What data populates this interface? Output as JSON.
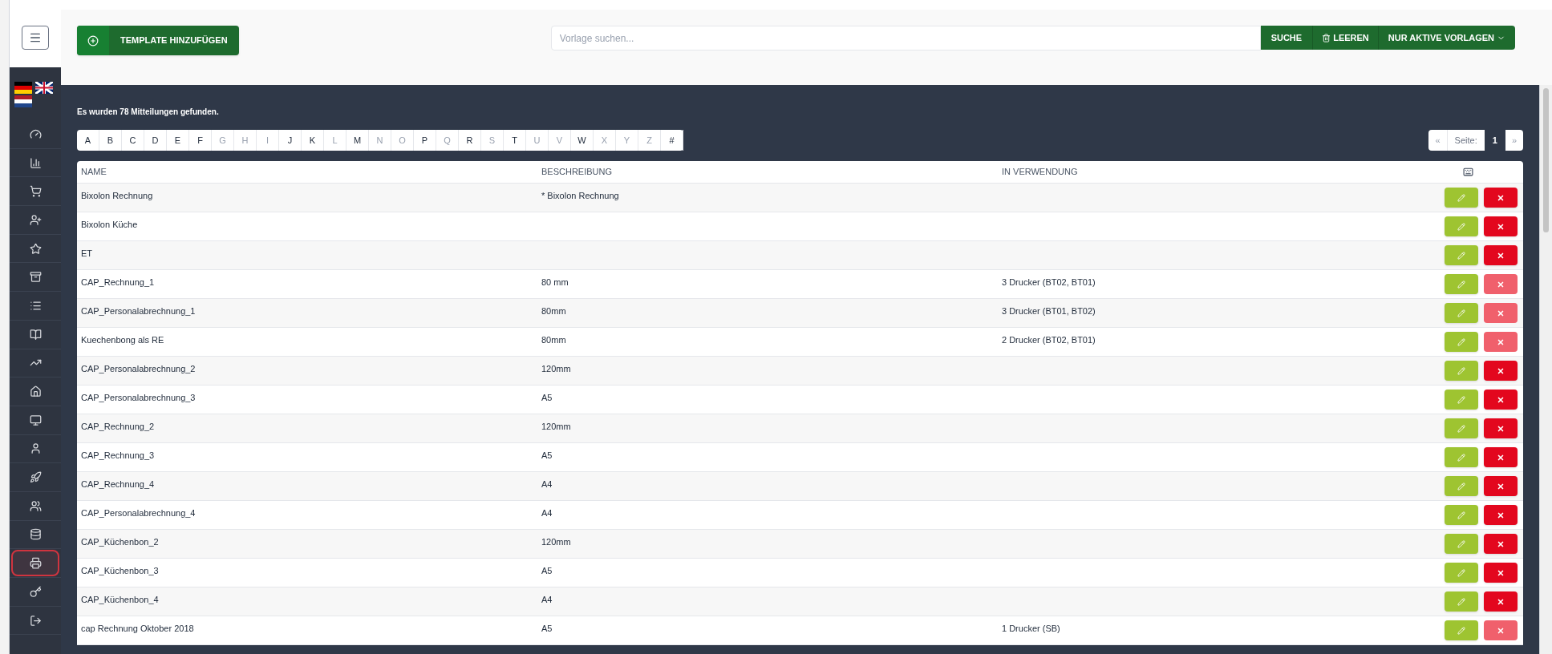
{
  "sidebar": {
    "languages": [
      {
        "kind": "de"
      },
      {
        "kind": "uk"
      },
      {
        "kind": "nl"
      }
    ],
    "items": [
      {
        "kind": "gauge",
        "selected": false
      },
      {
        "kind": "chart",
        "selected": false
      },
      {
        "kind": "cart",
        "selected": false
      },
      {
        "kind": "user-plus",
        "selected": false
      },
      {
        "kind": "star",
        "selected": false
      },
      {
        "kind": "archive",
        "selected": false
      },
      {
        "kind": "list",
        "selected": false
      },
      {
        "kind": "book",
        "selected": false
      },
      {
        "kind": "trend",
        "selected": false
      },
      {
        "kind": "home",
        "selected": false
      },
      {
        "kind": "monitor",
        "selected": false
      },
      {
        "kind": "user",
        "selected": false
      },
      {
        "kind": "rocket",
        "selected": false
      },
      {
        "kind": "users",
        "selected": false
      },
      {
        "kind": "database",
        "selected": false
      },
      {
        "kind": "printer",
        "selected": true
      },
      {
        "kind": "key",
        "selected": false
      },
      {
        "kind": "logout",
        "selected": false
      }
    ]
  },
  "toolbar": {
    "add_button": "TEMPLATE HINZUFÜGEN",
    "search": {
      "placeholder": "Vorlage suchen..."
    },
    "search_button": "SUCHE",
    "clear_button": "LEEREN",
    "filter_button": "NUR AKTIVE VORLAGEN"
  },
  "result_text": "Es wurden 78 Mitteilungen gefunden.",
  "alphabet": [
    {
      "label": "A",
      "disabled": false
    },
    {
      "label": "B",
      "disabled": false
    },
    {
      "label": "C",
      "disabled": false
    },
    {
      "label": "D",
      "disabled": false
    },
    {
      "label": "E",
      "disabled": false
    },
    {
      "label": "F",
      "disabled": false
    },
    {
      "label": "G",
      "disabled": true
    },
    {
      "label": "H",
      "disabled": true
    },
    {
      "label": "I",
      "disabled": true
    },
    {
      "label": "J",
      "disabled": false
    },
    {
      "label": "K",
      "disabled": false
    },
    {
      "label": "L",
      "disabled": true
    },
    {
      "label": "M",
      "disabled": false
    },
    {
      "label": "N",
      "disabled": true
    },
    {
      "label": "O",
      "disabled": true
    },
    {
      "label": "P",
      "disabled": false
    },
    {
      "label": "Q",
      "disabled": true
    },
    {
      "label": "R",
      "disabled": false
    },
    {
      "label": "S",
      "disabled": true
    },
    {
      "label": "T",
      "disabled": false
    },
    {
      "label": "U",
      "disabled": true
    },
    {
      "label": "V",
      "disabled": true
    },
    {
      "label": "W",
      "disabled": false
    },
    {
      "label": "X",
      "disabled": true
    },
    {
      "label": "Y",
      "disabled": true
    },
    {
      "label": "Z",
      "disabled": true
    },
    {
      "label": "#",
      "disabled": false
    }
  ],
  "pagination": {
    "prev": "«",
    "label": "Seite:",
    "page": "1",
    "next": "»"
  },
  "table": {
    "columns": [
      "NAME",
      "BESCHREIBUNG",
      "IN VERWENDUNG"
    ],
    "rows": [
      {
        "name": "Bixolon Rechnung",
        "description": "* Bixolon Rechnung",
        "in_use": "",
        "delete_disabled": false
      },
      {
        "name": "Bixolon Küche",
        "description": "",
        "in_use": "",
        "delete_disabled": false
      },
      {
        "name": "ET",
        "description": "",
        "in_use": "",
        "delete_disabled": false
      },
      {
        "name": "CAP_Rechnung_1",
        "description": "80 mm",
        "in_use": "3 Drucker (BT02, BT01)",
        "delete_disabled": true
      },
      {
        "name": "CAP_Personalabrechnung_1",
        "description": "80mm",
        "in_use": "3 Drucker (BT01, BT02)",
        "delete_disabled": true
      },
      {
        "name": "Kuechenbong als RE",
        "description": "80mm",
        "in_use": "2 Drucker (BT02, BT01)",
        "delete_disabled": true
      },
      {
        "name": "CAP_Personalabrechnung_2",
        "description": "120mm",
        "in_use": "",
        "delete_disabled": false
      },
      {
        "name": "CAP_Personalabrechnung_3",
        "description": "A5",
        "in_use": "",
        "delete_disabled": false
      },
      {
        "name": "CAP_Rechnung_2",
        "description": "120mm",
        "in_use": "",
        "delete_disabled": false
      },
      {
        "name": "CAP_Rechnung_3",
        "description": "A5",
        "in_use": "",
        "delete_disabled": false
      },
      {
        "name": "CAP_Rechnung_4",
        "description": "A4",
        "in_use": "",
        "delete_disabled": false
      },
      {
        "name": "CAP_Personalabrechnung_4",
        "description": "A4",
        "in_use": "",
        "delete_disabled": false
      },
      {
        "name": "CAP_Küchenbon_2",
        "description": "120mm",
        "in_use": "",
        "delete_disabled": false
      },
      {
        "name": "CAP_Küchenbon_3",
        "description": "A5",
        "in_use": "",
        "delete_disabled": false
      },
      {
        "name": "CAP_Küchenbon_4",
        "description": "A4",
        "in_use": "",
        "delete_disabled": false
      },
      {
        "name": "cap Rechnung Oktober 2018",
        "description": "A5",
        "in_use": "1 Drucker (SB)",
        "delete_disabled": true
      }
    ]
  }
}
